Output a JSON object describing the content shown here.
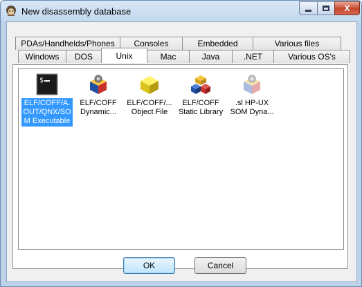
{
  "window": {
    "title": "New disassembly database",
    "minimize_glyph": "",
    "close_glyph": "X"
  },
  "tabs": {
    "row_back": [
      "PDAs/Handhelds/Phones",
      "Consoles",
      "Embedded",
      "Various files"
    ],
    "row_front": [
      "Windows",
      "DOS",
      "Unix",
      "Mac",
      "Java",
      ".NET",
      "Various OS's"
    ],
    "active": "Unix"
  },
  "items": [
    {
      "label": "ELF/COFF/A.OUT/QNX/SOM Executable",
      "lines": [
        "ELF/COFF/A.",
        "OUT/QNX/SO",
        "M Executable"
      ],
      "icon": "console-executable-icon",
      "selected": true
    },
    {
      "label": "ELF/COFF Dynamic...",
      "lines": [
        "ELF/COFF",
        "Dynamic..."
      ],
      "icon": "gear-cube-icon",
      "selected": false
    },
    {
      "label": "ELF/COFF/... Object File",
      "lines": [
        "ELF/COFF/...",
        "Object File"
      ],
      "icon": "yellow-cube-icon",
      "selected": false
    },
    {
      "label": "ELF/COFF Static Library",
      "lines": [
        "ELF/COFF",
        "Static Library"
      ],
      "icon": "library-cubes-icon",
      "selected": false
    },
    {
      "label": ".sl HP-UX SOM Dyna...",
      "lines": [
        ".sl HP-UX",
        "SOM Dyna..."
      ],
      "icon": "gear-cube-faded-icon",
      "selected": false
    }
  ],
  "buttons": {
    "ok": "OK",
    "cancel": "Cancel"
  },
  "colors": {
    "selection": "#3399ff",
    "frame": "#bcd3ea"
  }
}
